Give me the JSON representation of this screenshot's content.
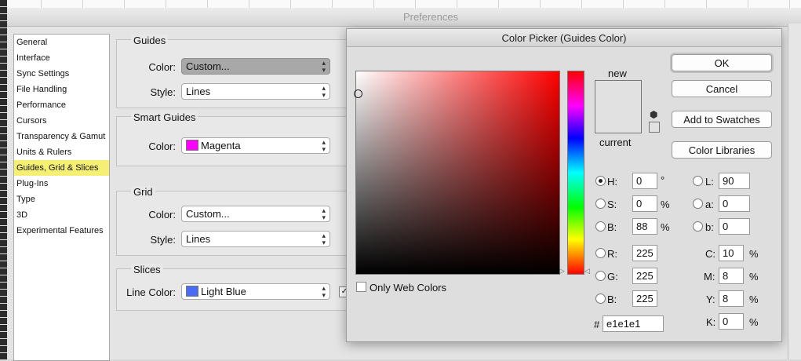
{
  "preferences": {
    "title": "Preferences",
    "sidebar": {
      "items": [
        {
          "label": "General"
        },
        {
          "label": "Interface"
        },
        {
          "label": "Sync Settings"
        },
        {
          "label": "File Handling"
        },
        {
          "label": "Performance"
        },
        {
          "label": "Cursors"
        },
        {
          "label": "Transparency & Gamut"
        },
        {
          "label": "Units & Rulers"
        },
        {
          "label": "Guides, Grid & Slices"
        },
        {
          "label": "Plug-Ins"
        },
        {
          "label": "Type"
        },
        {
          "label": "3D"
        },
        {
          "label": "Experimental Features"
        }
      ],
      "selected": "Guides, Grid & Slices"
    },
    "guides": {
      "title": "Guides",
      "color_label": "Color:",
      "color_value": "Custom...",
      "style_label": "Style:",
      "style_value": "Lines"
    },
    "smart_guides": {
      "title": "Smart Guides",
      "color_label": "Color:",
      "color_value": "Magenta",
      "swatch": "#ff00ff"
    },
    "grid": {
      "title": "Grid",
      "color_label": "Color:",
      "color_value": "Custom...",
      "style_label": "Style:",
      "style_value": "Lines"
    },
    "slices": {
      "title": "Slices",
      "line_color_label": "Line Color:",
      "line_color_value": "Light Blue",
      "swatch": "#4a6cf4",
      "checkbox_checked": true
    }
  },
  "color_picker": {
    "title": "Color Picker (Guides Color)",
    "new_label": "new",
    "current_label": "current",
    "selected_color": "#e1e1e1",
    "buttons": {
      "ok": "OK",
      "cancel": "Cancel",
      "add_to_swatches": "Add to Swatches",
      "color_libraries": "Color Libraries"
    },
    "only_web_colors": "Only Web Colors",
    "only_web_colors_checked": false,
    "selected_mode": "H",
    "hsb": {
      "h_label": "H:",
      "h_value": "0",
      "h_unit": "°",
      "s_label": "S:",
      "s_value": "0",
      "s_unit": "%",
      "b_label": "B:",
      "b_value": "88",
      "b_unit": "%"
    },
    "rgb": {
      "r_label": "R:",
      "r_value": "225",
      "g_label": "G:",
      "g_value": "225",
      "b_label": "B:",
      "b_value": "225"
    },
    "lab": {
      "l_label": "L:",
      "l_value": "90",
      "a_label": "a:",
      "a_value": "0",
      "b_label": "b:",
      "b_value": "0"
    },
    "cmyk": {
      "c_label": "C:",
      "c_value": "10",
      "c_unit": "%",
      "m_label": "M:",
      "m_value": "8",
      "m_unit": "%",
      "y_label": "Y:",
      "y_value": "8",
      "y_unit": "%",
      "k_label": "K:",
      "k_value": "0",
      "k_unit": "%"
    },
    "hex_label": "#",
    "hex_value": "e1e1e1"
  }
}
